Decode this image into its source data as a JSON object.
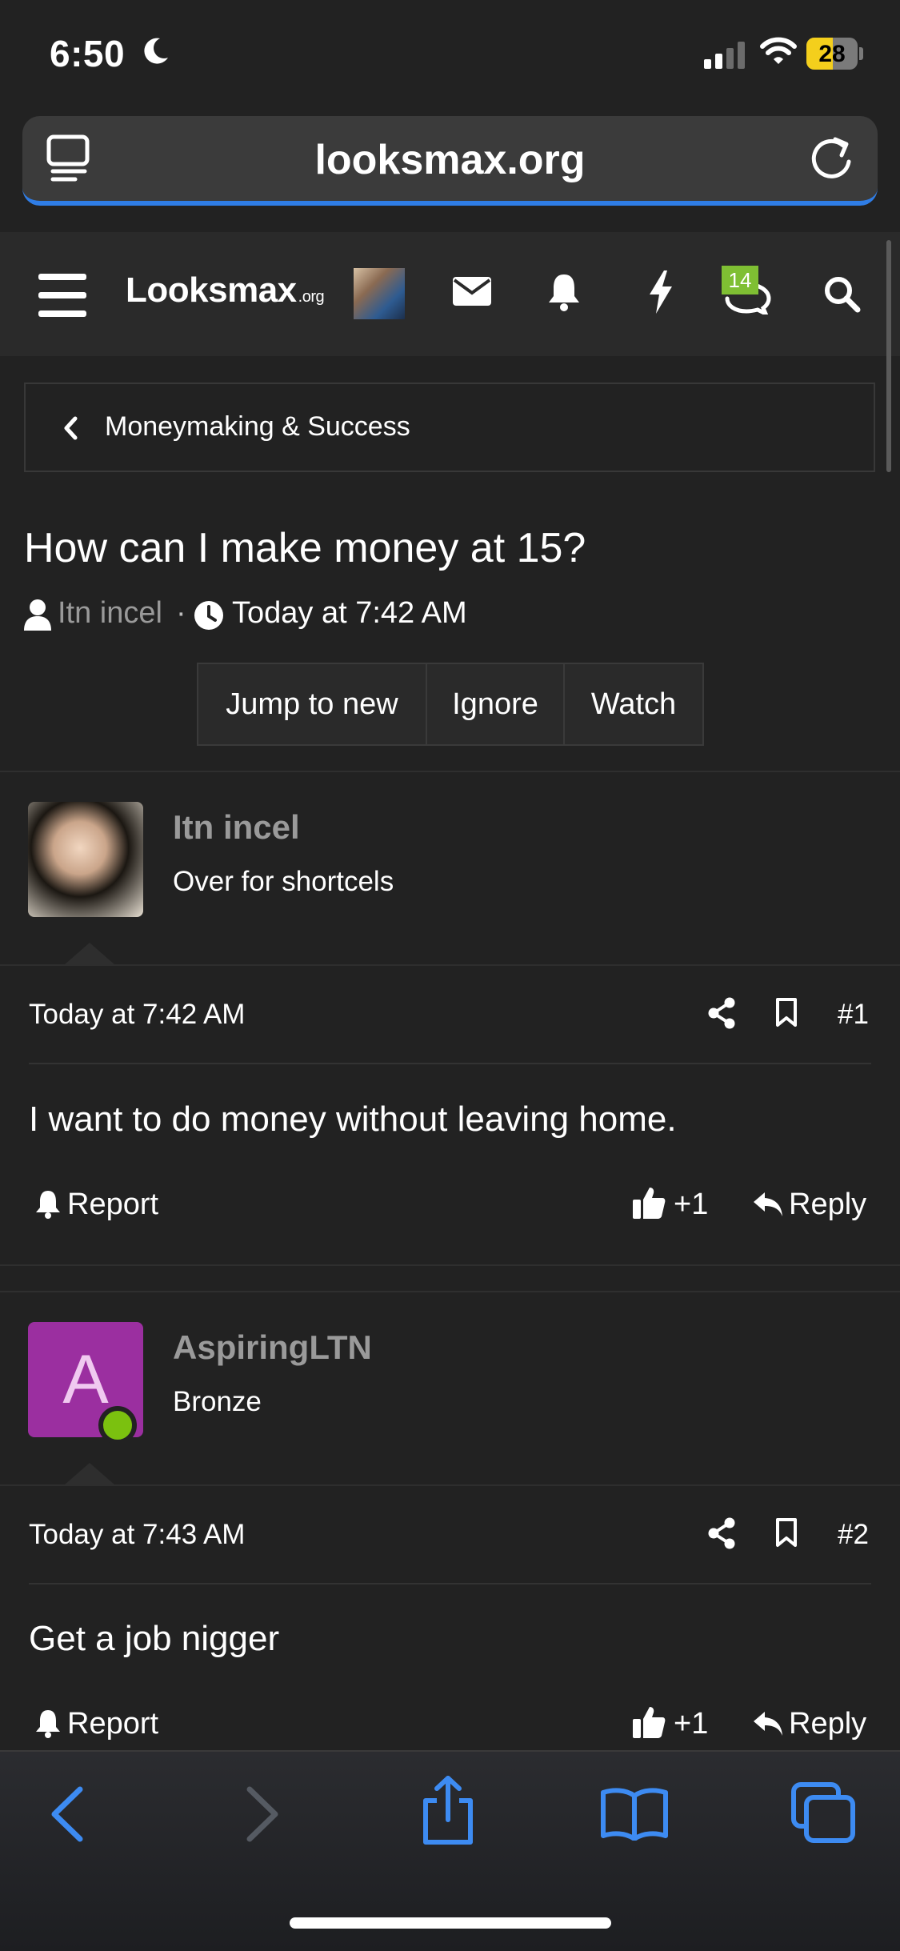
{
  "status_bar": {
    "time": "6:50",
    "battery_level": "28",
    "icons": [
      "moon-icon",
      "signal-icon",
      "wifi-icon",
      "battery-icon"
    ]
  },
  "browser": {
    "url": "looksmax.org",
    "accent_color": "#2f7de6"
  },
  "site": {
    "logo_main": "Looksmax",
    "logo_suffix": ".org",
    "conversations_badge": "14",
    "badge_color": "#7fbf33"
  },
  "breadcrumb": {
    "label": "Moneymaking & Success"
  },
  "thread": {
    "title": "How can I make money at 15?",
    "author": "Itn incel",
    "separator": "·",
    "time": "Today at 7:42 AM",
    "buttons": [
      "Jump to new",
      "Ignore",
      "Watch"
    ]
  },
  "posts": [
    {
      "username": "Itn incel",
      "user_title": "Over for shortcels",
      "time": "Today at 7:42 AM",
      "number": "#1",
      "body": "I want to do money without leaving home.",
      "report_label": "Report",
      "like_count": "+1",
      "reply_label": "Reply"
    },
    {
      "username": "AspiringLTN",
      "avatar_letter": "A",
      "avatar_color": "#9b2fa0",
      "online": true,
      "user_title": "Bronze",
      "time": "Today at 7:43 AM",
      "number": "#2",
      "body": "Get a job nigger",
      "report_label": "Report",
      "like_count": "+1",
      "reply_label": "Reply"
    }
  ],
  "toolbar": {
    "icons": [
      "back-icon",
      "forward-icon",
      "share-icon",
      "bookmarks-icon",
      "tabs-icon"
    ],
    "icon_color": "#3d8bf2"
  }
}
